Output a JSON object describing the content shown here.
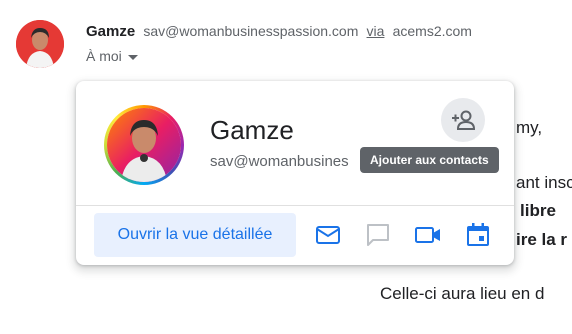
{
  "header": {
    "sender_name": "Gamze",
    "sender_email": "sav@womanbusinesspassion.com",
    "via_label": "via",
    "via_domain": "acems2.com",
    "recipient_label": "À moi"
  },
  "background_text": {
    "line1": "my,",
    "line2": "ant insc",
    "line3": "libre",
    "line4": "ire la r",
    "line5": "Celle-ci aura lieu en d"
  },
  "contact_card": {
    "name": "Gamze",
    "email": "sav@womanbusines",
    "add_contact_tooltip": "Ajouter aux contacts",
    "open_detail_label": "Ouvrir la vue détaillée",
    "actions": [
      "mail-icon",
      "chat-icon",
      "video-icon",
      "calendar-icon"
    ]
  },
  "colors": {
    "accent": "#1a73e8",
    "accent_bg": "#e8f0fe",
    "tooltip_bg": "#5f6368",
    "avatar_red": "#e53935",
    "icon_muted": "#bdc1c6"
  }
}
